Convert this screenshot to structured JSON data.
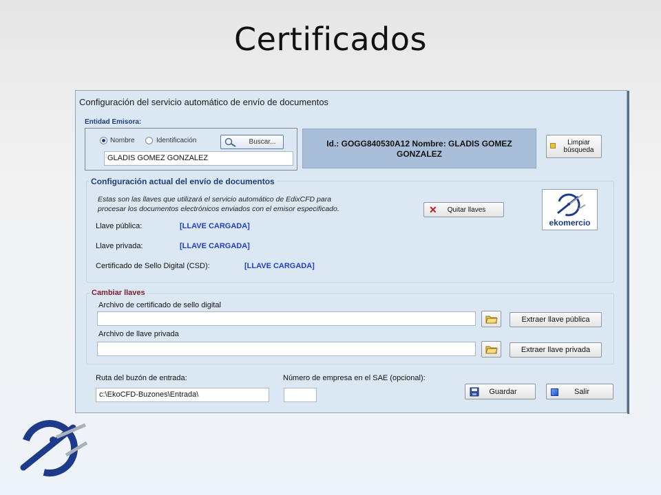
{
  "slide": {
    "title": "Certificados"
  },
  "window": {
    "title": "Configuración del servicio automático de envío de documentos"
  },
  "emisor": {
    "group_label": "Entidad Emisora:",
    "radio_nombre": "Nombre",
    "radio_identificacion": "Identificación",
    "search_button": "Buscar...",
    "name_value": "GLADIS GOMEZ GONZALEZ"
  },
  "info": {
    "text": "Id.: GOGG840530A12 Nombre: GLADIS GOMEZ GONZALEZ"
  },
  "clear_button": {
    "line1": "Limpiar",
    "line2": "búsqueda"
  },
  "config": {
    "title": "Configuración actual del envío de documentos",
    "description_line1": "Estas son las llaves que utilizará el servicio automático de EdixCFD para",
    "description_line2": "procesar los documentos electrónicos enviados con el emisor especificado.",
    "remove_button": "Quitar llaves",
    "public_key_label": "Llave pública:",
    "public_key_value": "[LLAVE CARGADA]",
    "private_key_label": "Llave privada:",
    "private_key_value": "[LLAVE CARGADA]",
    "csd_label": "Certificado de Sello Digital (CSD):",
    "csd_value": "[LLAVE CARGADA]",
    "logo_text": "ekomercio"
  },
  "change": {
    "title": "Cambiar llaves",
    "cert_file_label": "Archivo de certificado de sello digital",
    "cert_file_value": "",
    "extract_public_button": "Extraer llave pública",
    "key_file_label": "Archivo de llave privada",
    "key_file_value": "",
    "extract_private_button": "Extraer llave privada"
  },
  "footer": {
    "inbox_label": "Ruta del buzón de entrada:",
    "inbox_value": "c:\\EkoCFD-Buzones\\Entrada\\",
    "company_label": "Número de empresa en el SAE (opcional):",
    "company_value": "",
    "save_button": "Guardar",
    "exit_button": "Salir"
  },
  "colors": {
    "window_bg": "#dbe7f3",
    "info_bg": "#a9bfd9",
    "group_title": "#1f3f7a",
    "loaded_value": "#1f3fc8",
    "logo_blue": "#1e3a8a"
  }
}
